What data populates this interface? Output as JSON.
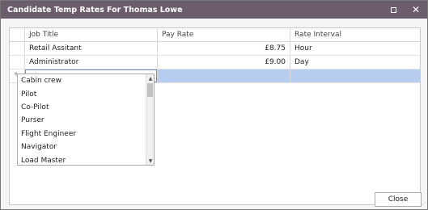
{
  "window": {
    "title": "Candidate Temp Rates For Thomas Lowe"
  },
  "icons": {
    "maximize": "maximize-icon",
    "close": "close-icon",
    "edit": "pencil-icon",
    "dropdown": "chevron-down-icon"
  },
  "grid": {
    "columns": [
      "Job Title",
      "Pay Rate",
      "Rate Interval"
    ],
    "rows": [
      {
        "job_title": "Retail Assitant",
        "pay_rate": "£8.75",
        "rate_interval": "Hour"
      },
      {
        "job_title": "Administrator",
        "pay_rate": "£9.00",
        "rate_interval": "Day"
      }
    ],
    "new_row": {
      "job_title": "",
      "pay_rate": "",
      "rate_interval": ""
    }
  },
  "dropdown": {
    "options": [
      "Cabin crew",
      "Pilot",
      "Co-Pilot",
      "Purser",
      "Flight Engineer",
      "Navigator",
      "Load Master"
    ]
  },
  "footer": {
    "close_label": "Close"
  },
  "colors": {
    "titlebar": "#6c5d6c",
    "selected_row": "#b7cdef",
    "combo_border": "#6b8cc5"
  }
}
